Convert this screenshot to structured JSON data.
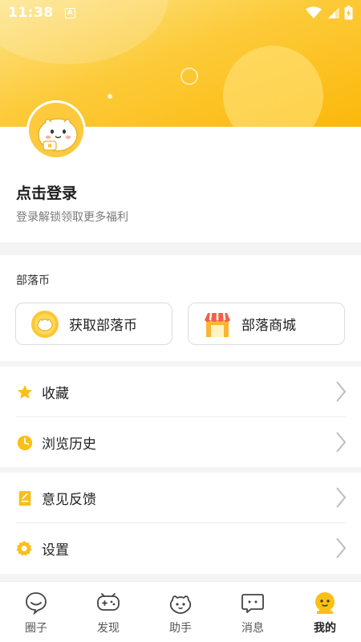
{
  "status_bar": {
    "time": "11:38",
    "a_badge": "A"
  },
  "profile": {
    "title": "点击登录",
    "subtitle": "登录解锁领取更多福利"
  },
  "coins": {
    "section_title": "部落币",
    "get_coins_label": "获取部落币",
    "shop_label": "部落商城"
  },
  "menu": {
    "favorites": "收藏",
    "history": "浏览历史",
    "feedback": "意见反馈",
    "settings": "设置"
  },
  "bottom_nav": {
    "items": [
      {
        "label": "圈子",
        "icon": "circle-chat-icon"
      },
      {
        "label": "发现",
        "icon": "gamepad-icon"
      },
      {
        "label": "助手",
        "icon": "assistant-icon"
      },
      {
        "label": "消息",
        "icon": "message-icon"
      },
      {
        "label": "我的",
        "icon": "profile-icon"
      }
    ],
    "active_index": 4
  },
  "colors": {
    "accent": "#fbbf16",
    "header_start": "#fde48a",
    "header_end": "#fbb80a"
  }
}
